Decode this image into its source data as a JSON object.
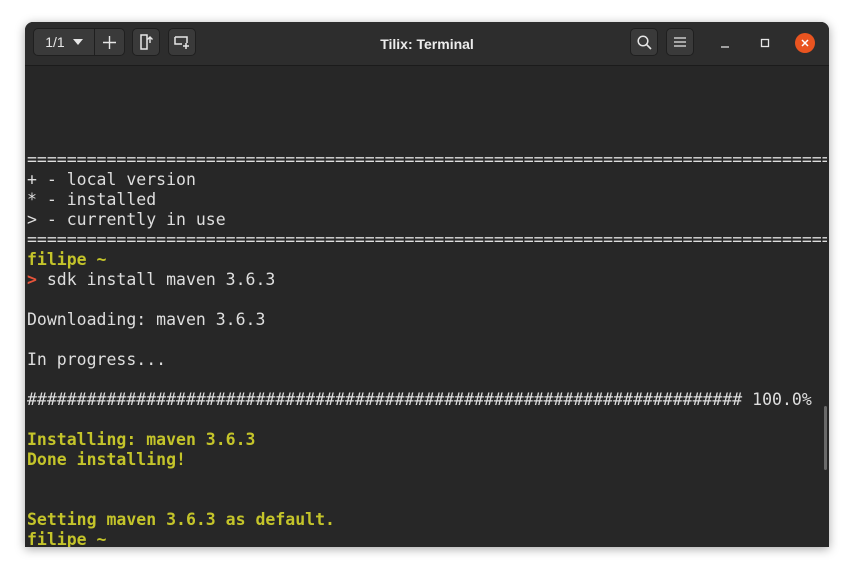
{
  "window": {
    "title": "Tilix: Terminal",
    "session_counter": "1/1",
    "icons": {
      "session_dropdown": "chevron-down-icon",
      "add_session": "plus-icon",
      "split_vertical": "split-terminal-icon",
      "new_tab": "add-terminal-icon",
      "search": "search-icon",
      "menu": "hamburger-menu-icon",
      "minimize": "minimize-icon",
      "maximize": "maximize-icon",
      "close": "close-icon"
    }
  },
  "colors": {
    "terminal_bg": "#272727",
    "text": "#dedede",
    "highlight_yellow": "#c4c42a",
    "prompt_arrow": "#e8543a",
    "close_button": "#e95420"
  },
  "terminal": {
    "separator": "=======================================================================================================================",
    "legend_local": "+ - local version",
    "legend_installed": "* - installed",
    "legend_in_use": "> - currently in use",
    "prompt_user": "filipe ~",
    "prompt_symbol": ">",
    "command": "sdk install maven 3.6.3",
    "downloading": "Downloading: maven 3.6.3",
    "in_progress": "In progress...",
    "progress_bar": "######################################################################## 100.0%",
    "progress_value": "100.0%",
    "installing": "Installing: maven 3.6.3",
    "done": "Done installing!",
    "setting_default": "Setting maven 3.6.3 as default.",
    "final_prompt": "filipe ~"
  }
}
